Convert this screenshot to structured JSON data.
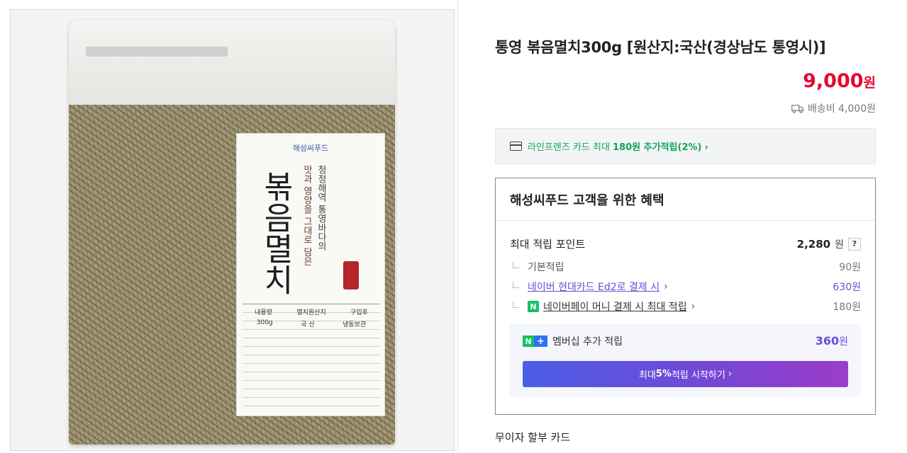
{
  "product": {
    "title": "통영 볶음멸치300g [원산지:국산(경상남도 통영시)]",
    "price_value": "9,000",
    "price_unit": "원",
    "shipping": "배송비 4,000원"
  },
  "package_label": {
    "brand": "해성씨푸드",
    "name": "볶음멸치",
    "tagline_1": "청정해역 통영바다의",
    "tagline_2": "맛과 영양을 그대로 담은",
    "info_headers": [
      "내용량",
      "멸치원산지",
      "구입후"
    ],
    "info_values": [
      "300g",
      "국 산",
      "냉동보관"
    ]
  },
  "card_banner": {
    "bold": "라인프렌즈 카드 최대 ",
    "amount": "180원",
    "rest": " 추가적립(2%)",
    "chevron": "›"
  },
  "benefit": {
    "title": "해성씨푸드 고객을 위한 혜택",
    "max_points_label": "최대 적립 포인트",
    "max_points_value": "2,280",
    "max_points_unit": "원",
    "help": "?",
    "rows": [
      {
        "label": "기본적립",
        "value": "90원"
      },
      {
        "label": "네이버 현대카드 Ed2로 결제 시",
        "value": "630원"
      },
      {
        "label": "네이버페이 머니 결제 시 최대 적립",
        "value": "180원"
      }
    ],
    "chevron": "›"
  },
  "membership": {
    "n_badge": "N",
    "plus_badge": "+",
    "label": "멤버십 추가 적립",
    "value": "360",
    "unit": "원",
    "button_pre": "최대 ",
    "button_bold": "5%",
    "button_post": " 적립 시작하기",
    "button_chevron": "›"
  },
  "installment": {
    "label": "무이자 할부 카드"
  },
  "colors": {
    "price": "#e30b2e",
    "card_green": "#11a35a",
    "link_purple": "#6a4ed9",
    "naver_green": "#12c263"
  }
}
